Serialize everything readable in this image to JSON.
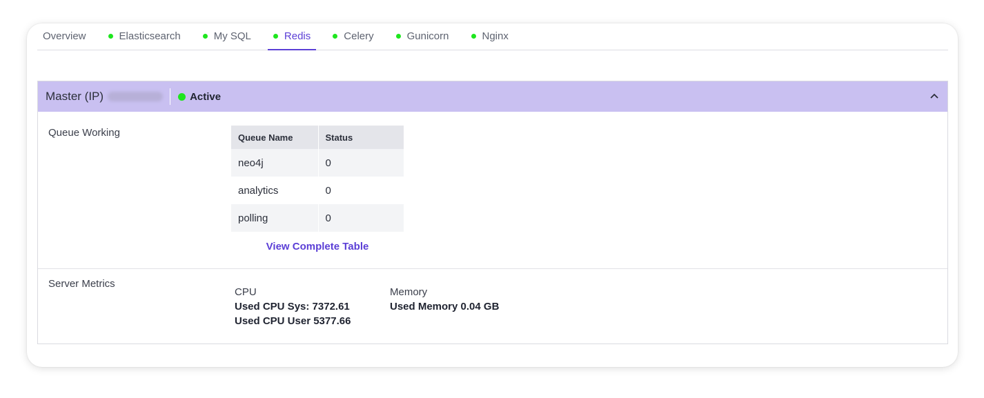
{
  "tabs": [
    {
      "label": "Overview",
      "dot": false,
      "active": false
    },
    {
      "label": "Elasticsearch",
      "dot": true,
      "active": false
    },
    {
      "label": "My SQL",
      "dot": true,
      "active": false
    },
    {
      "label": "Redis",
      "dot": true,
      "active": true
    },
    {
      "label": "Celery",
      "dot": true,
      "active": false
    },
    {
      "label": "Gunicorn",
      "dot": true,
      "active": false
    },
    {
      "label": "Nginx",
      "dot": true,
      "active": false
    }
  ],
  "panel": {
    "title": "Master (IP)",
    "status": "Active",
    "status_color": "#1ee61e",
    "header_color": "#c9c0f1",
    "expanded": true
  },
  "queue": {
    "label": "Queue Working",
    "columns": [
      "Queue Name",
      "Status"
    ],
    "rows": [
      {
        "name": "neo4j",
        "status": "0"
      },
      {
        "name": "analytics",
        "status": "0"
      },
      {
        "name": "polling",
        "status": "0"
      }
    ],
    "view_link": "View Complete Table"
  },
  "metrics": {
    "label": "Server Metrics",
    "cpu": {
      "heading": "CPU",
      "sys_label": "Used CPU Sys:",
      "sys_value": "7372.61",
      "user_label": "Used CPU User",
      "user_value": "5377.66"
    },
    "memory": {
      "heading": "Memory",
      "used_label": "Used Memory",
      "used_value": "0.04 GB"
    }
  },
  "accent_color": "#5b3fd6"
}
